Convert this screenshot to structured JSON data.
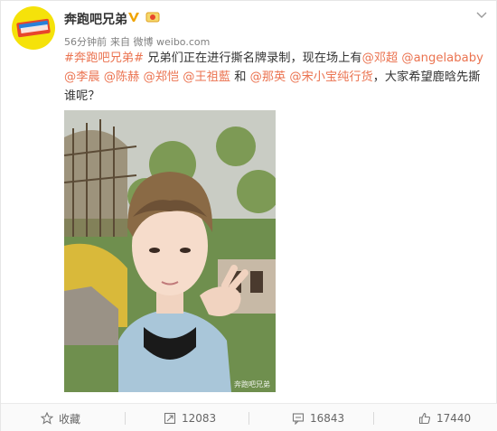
{
  "post": {
    "author": "奔跑吧兄弟",
    "time": "56分钟前",
    "source": "来自 微博 weibo.com",
    "content": [
      {
        "type": "link",
        "text": "#奔跑吧兄弟#"
      },
      {
        "type": "text",
        "text": " 兄弟们正在进行撕名牌录制，现在场上有"
      },
      {
        "type": "link",
        "text": "@邓超"
      },
      {
        "type": "text",
        "text": " "
      },
      {
        "type": "link",
        "text": "@angelababy"
      },
      {
        "type": "text",
        "text": " "
      },
      {
        "type": "link",
        "text": "@李晨"
      },
      {
        "type": "text",
        "text": " "
      },
      {
        "type": "link",
        "text": "@陈赫"
      },
      {
        "type": "text",
        "text": " "
      },
      {
        "type": "link",
        "text": "@郑恺"
      },
      {
        "type": "text",
        "text": " "
      },
      {
        "type": "link",
        "text": "@王祖藍"
      },
      {
        "type": "text",
        "text": " 和 "
      },
      {
        "type": "link",
        "text": "@那英"
      },
      {
        "type": "text",
        "text": " "
      },
      {
        "type": "link",
        "text": "@宋小宝纯行货"
      },
      {
        "type": "text",
        "text": "，大家希望鹿晗先撕谁呢？"
      }
    ],
    "watermark": "奔跑吧兄弟"
  },
  "actions": {
    "favorite": "收藏",
    "repost": "12083",
    "comment": "16843",
    "like": "17440"
  },
  "colors": {
    "link": "#eb7350",
    "vip": "#f0a400"
  }
}
